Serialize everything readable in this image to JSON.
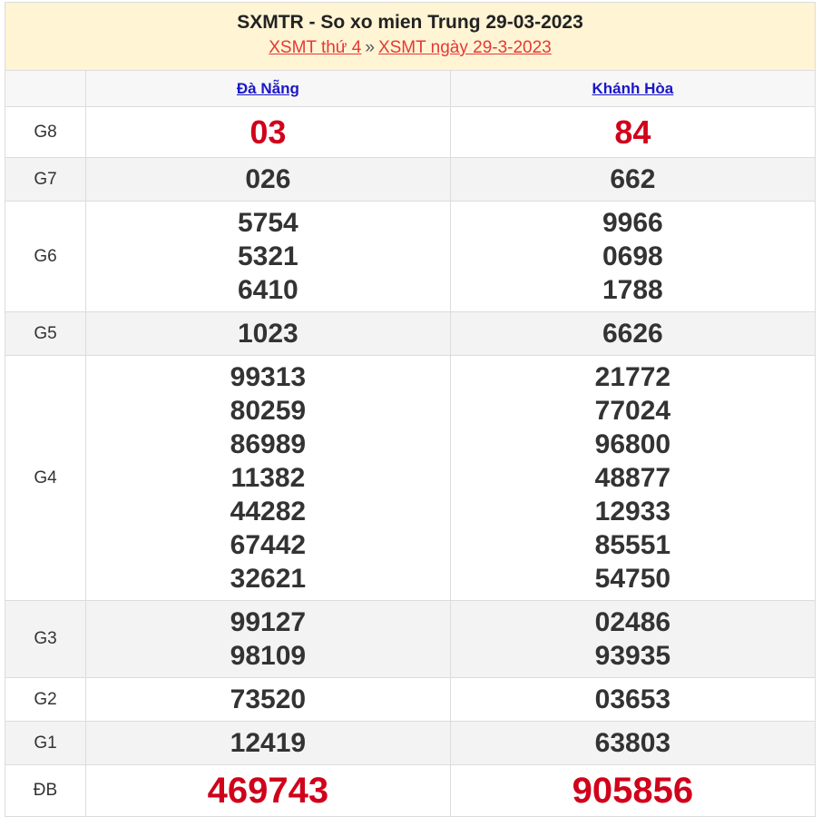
{
  "header": {
    "title": "SXMTR - So xo mien Trung 29-03-2023",
    "link1": "XSMT thứ 4",
    "separator": "»",
    "link2": "XSMT ngày 29-3-2023"
  },
  "provinces": [
    "Đà Nẵng",
    "Khánh Hòa"
  ],
  "prizes": {
    "g8": {
      "label": "G8",
      "a": [
        "03"
      ],
      "b": [
        "84"
      ]
    },
    "g7": {
      "label": "G7",
      "a": [
        "026"
      ],
      "b": [
        "662"
      ]
    },
    "g6": {
      "label": "G6",
      "a": [
        "5754",
        "5321",
        "6410"
      ],
      "b": [
        "9966",
        "0698",
        "1788"
      ]
    },
    "g5": {
      "label": "G5",
      "a": [
        "1023"
      ],
      "b": [
        "6626"
      ]
    },
    "g4": {
      "label": "G4",
      "a": [
        "99313",
        "80259",
        "86989",
        "11382",
        "44282",
        "67442",
        "32621"
      ],
      "b": [
        "21772",
        "77024",
        "96800",
        "48877",
        "12933",
        "85551",
        "54750"
      ]
    },
    "g3": {
      "label": "G3",
      "a": [
        "99127",
        "98109"
      ],
      "b": [
        "02486",
        "93935"
      ]
    },
    "g2": {
      "label": "G2",
      "a": [
        "73520"
      ],
      "b": [
        "03653"
      ]
    },
    "g1": {
      "label": "G1",
      "a": [
        "12419"
      ],
      "b": [
        "63803"
      ]
    },
    "db": {
      "label": "ĐB",
      "a": [
        "469743"
      ],
      "b": [
        "905856"
      ]
    }
  },
  "colors": {
    "header_bg": "#fff4d4",
    "link_red": "#e53935",
    "province_link": "#1a17c8",
    "prize_red": "#d0021b",
    "alt_row": "#f3f3f3"
  }
}
